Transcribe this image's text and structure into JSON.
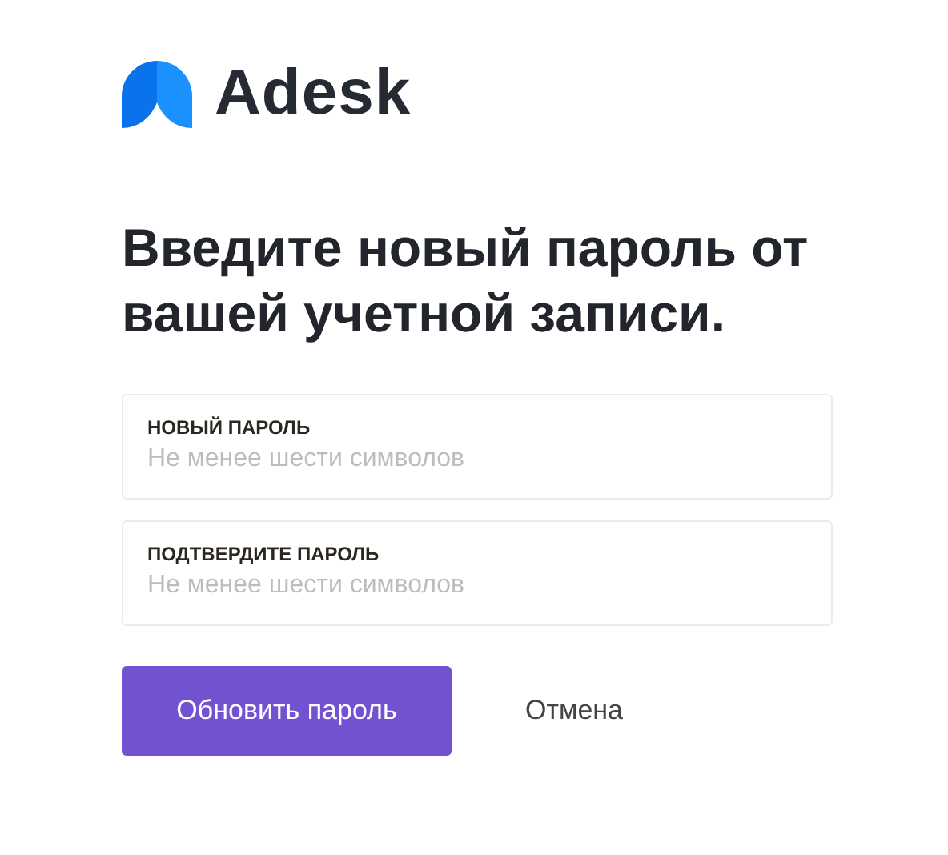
{
  "logo": {
    "name": "Adesk"
  },
  "heading": "Введите новый пароль от вашей учетной записи.",
  "fields": [
    {
      "label": "НОВЫЙ ПАРОЛЬ",
      "placeholder": "Не менее шести символов"
    },
    {
      "label": "ПОДТВЕРДИТЕ ПАРОЛЬ",
      "placeholder": "Не менее шести символов"
    }
  ],
  "buttons": [
    {
      "kind": "primary",
      "label": "Обновить пароль"
    },
    {
      "kind": "link",
      "label": "Отмена"
    }
  ]
}
